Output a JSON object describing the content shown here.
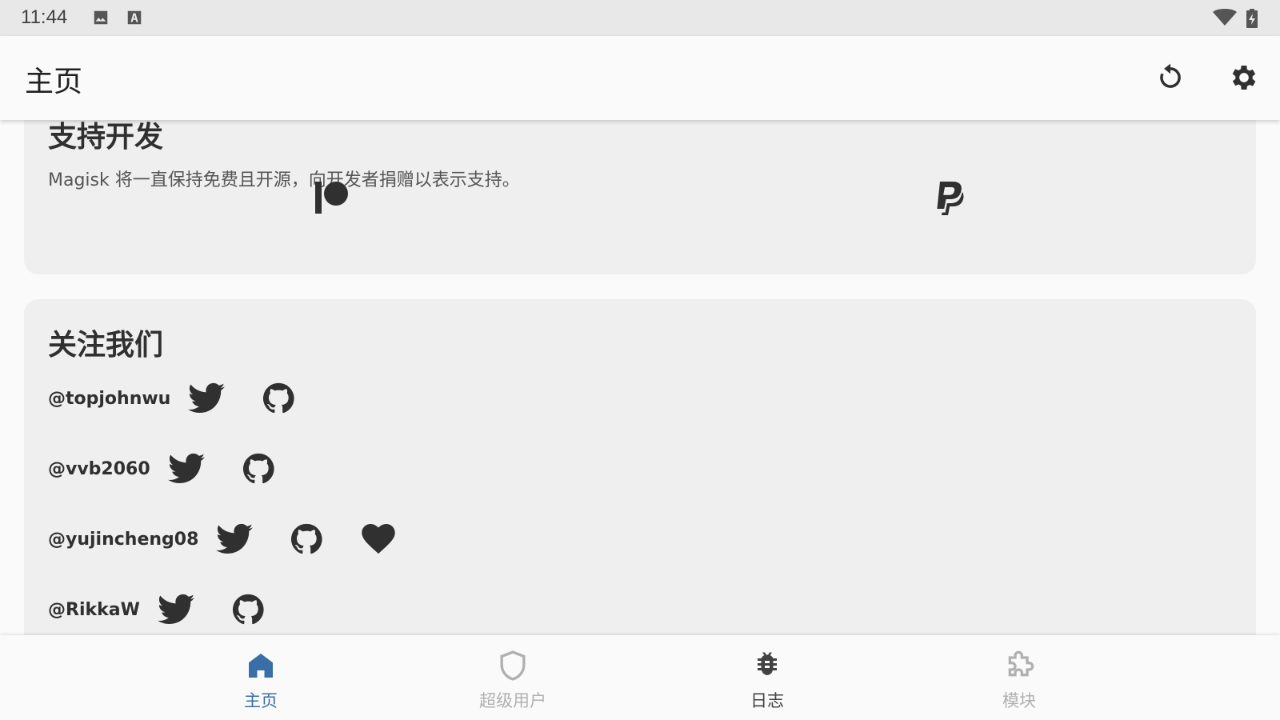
{
  "status_bar": {
    "time": "11:44",
    "icons": [
      "image-icon",
      "keyboard-a-icon",
      "wifi-icon",
      "battery-charging-icon"
    ]
  },
  "app_bar": {
    "title": "主页",
    "actions": [
      "refresh-icon",
      "settings-gear-icon"
    ]
  },
  "support_card": {
    "title": "支持开发",
    "description": "Magisk 将一直保持免费且开源，向开发者捐赠以表示支持。",
    "donate_buttons": [
      "patreon-icon",
      "paypal-icon"
    ]
  },
  "follow_card": {
    "title": "关注我们",
    "developers": [
      {
        "handle": "@topjohnwu",
        "links": [
          "twitter-icon",
          "github-icon"
        ]
      },
      {
        "handle": "@vvb2060",
        "links": [
          "twitter-icon",
          "github-icon"
        ]
      },
      {
        "handle": "@yujincheng08",
        "links": [
          "twitter-icon",
          "github-icon",
          "heart-icon"
        ]
      },
      {
        "handle": "@RikkaW",
        "links": [
          "twitter-icon",
          "github-icon"
        ]
      }
    ]
  },
  "bottom_nav": {
    "items": [
      {
        "label": "主页",
        "icon": "home-icon",
        "state": "active"
      },
      {
        "label": "超级用户",
        "icon": "shield-icon",
        "state": "disabled"
      },
      {
        "label": "日志",
        "icon": "bug-icon",
        "state": "normal"
      },
      {
        "label": "模块",
        "icon": "puzzle-icon",
        "state": "disabled"
      }
    ]
  },
  "colors": {
    "accent": "#3a6ea8",
    "icon_dark": "#303030",
    "disabled": "#b0b0b0",
    "card_bg": "#efefef",
    "page_bg": "#fafafa",
    "status_bar_bg": "#e8e8e8"
  }
}
